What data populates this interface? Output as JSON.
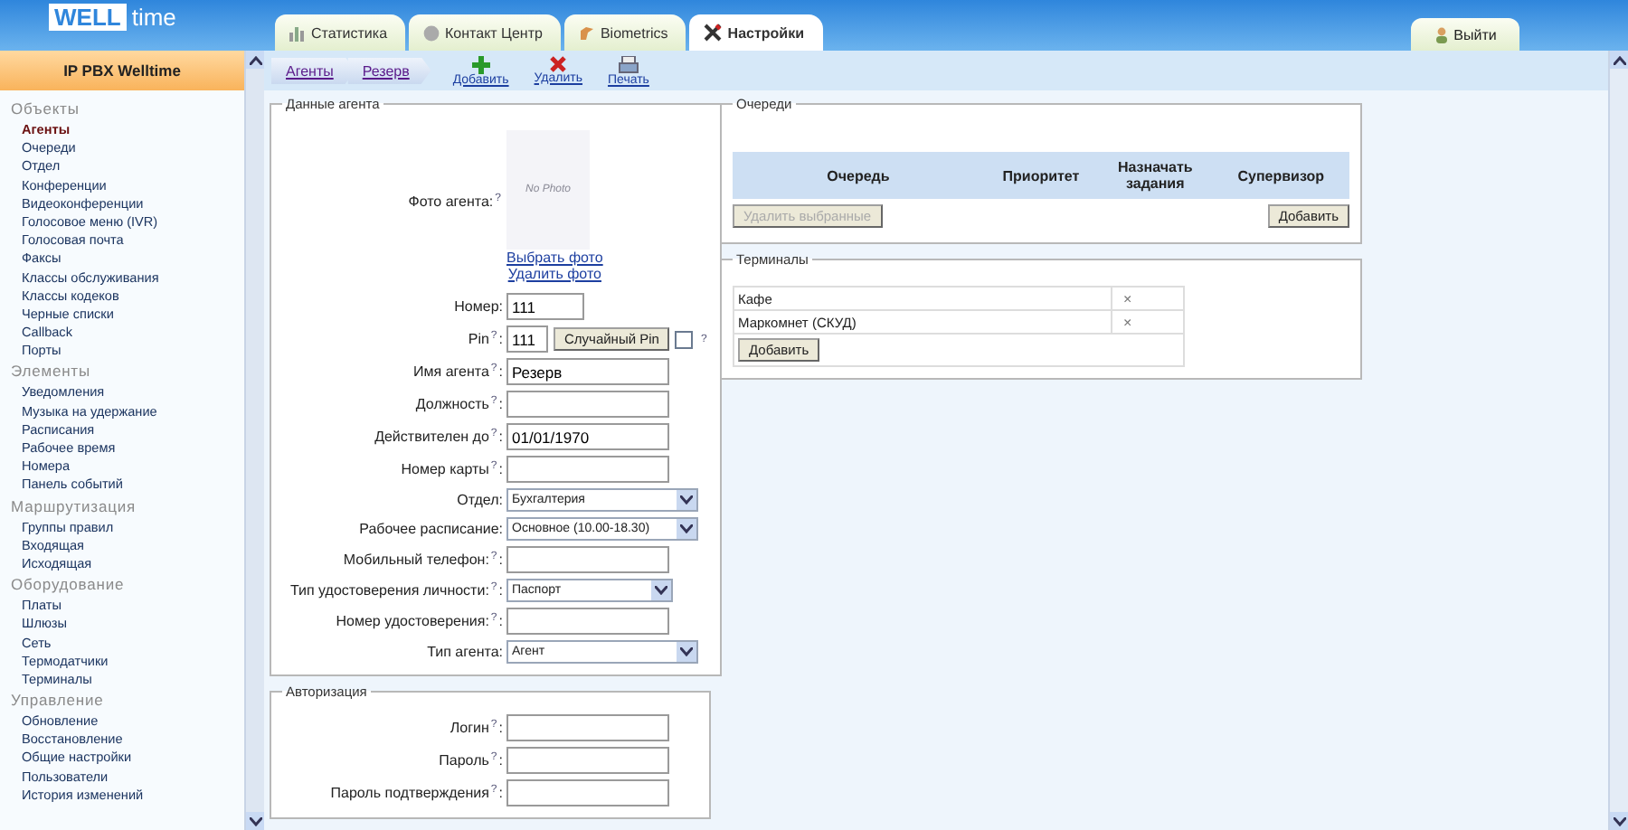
{
  "logo": {
    "part1": "WELL",
    "part2": "time"
  },
  "tabs": [
    {
      "label": "Статистика",
      "kind": "stats",
      "selected": false
    },
    {
      "label": "Контакт Центр",
      "kind": "contact",
      "selected": false
    },
    {
      "label": "Biometrics",
      "kind": "biometrics",
      "selected": false
    },
    {
      "label": "Настройки",
      "kind": "settings",
      "selected": true
    }
  ],
  "logout": "Выйти",
  "sidebar": {
    "title": "IP PBX Welltime",
    "groups": [
      {
        "title": "Объекты",
        "items": [
          {
            "label": "Агенты",
            "selected": true
          },
          {
            "label": "Очереди",
            "selected": false
          },
          {
            "label": "Отдел",
            "selected": false
          },
          {
            "label": "Конференции",
            "selected": false
          },
          {
            "label": "Видеоконференции",
            "selected": false
          },
          {
            "label": "Голосовое меню (IVR)",
            "selected": false
          },
          {
            "label": "Голосовая почта",
            "selected": false
          },
          {
            "label": "Факсы",
            "selected": false
          },
          {
            "label": "Классы обслуживания",
            "selected": false
          },
          {
            "label": "Классы кодеков",
            "selected": false
          },
          {
            "label": "Черные списки",
            "selected": false
          },
          {
            "label": "Callback",
            "selected": false
          },
          {
            "label": "Порты",
            "selected": false
          }
        ]
      },
      {
        "title": "Элементы",
        "items": [
          {
            "label": "Уведомления",
            "selected": false
          },
          {
            "label": "Музыка на удержание",
            "selected": false
          },
          {
            "label": "Расписания",
            "selected": false
          },
          {
            "label": "Рабочее время",
            "selected": false
          },
          {
            "label": "Номера",
            "selected": false
          },
          {
            "label": "Панель событий",
            "selected": false
          }
        ]
      },
      {
        "title": "Маршрутизация",
        "items": [
          {
            "label": "Группы правил",
            "selected": false
          },
          {
            "label": "Входящая",
            "selected": false
          },
          {
            "label": "Исходящая",
            "selected": false
          }
        ]
      },
      {
        "title": "Оборудование",
        "items": [
          {
            "label": "Платы",
            "selected": false
          },
          {
            "label": "Шлюзы",
            "selected": false
          },
          {
            "label": "Сеть",
            "selected": false
          },
          {
            "label": "Термодатчики",
            "selected": false
          },
          {
            "label": "Терминалы",
            "selected": false
          }
        ]
      },
      {
        "title": "Управление",
        "items": [
          {
            "label": "Обновление",
            "selected": false
          },
          {
            "label": "Восстановление",
            "selected": false
          },
          {
            "label": "Общие настройки",
            "selected": false
          },
          {
            "label": "Пользователи",
            "selected": false
          },
          {
            "label": "История изменений",
            "selected": false
          }
        ]
      }
    ]
  },
  "breadcrumb": [
    "Агенты",
    "Резерв"
  ],
  "actions": [
    {
      "label": "Добавить",
      "kind": "add"
    },
    {
      "label": "Удалить",
      "kind": "delete"
    },
    {
      "label": "Печать",
      "kind": "print"
    }
  ],
  "agent_data": {
    "legend": "Данные агента",
    "photo": {
      "label": "Фото агента:",
      "help": "?",
      "placeholder": "No Photo",
      "links": [
        "Выбрать фото",
        "Удалить фото"
      ]
    },
    "fields": [
      {
        "kind": "short",
        "label": "Номер:",
        "value": "111"
      },
      {
        "kind": "pin",
        "label": "Pin",
        "help": "?",
        "suffix": ":",
        "value": "111",
        "button": "Случайный Pin",
        "checked": false,
        "check_help": "?"
      },
      {
        "kind": "text",
        "label": "Имя агента",
        "help": "?",
        "suffix": ":",
        "value": "Резерв"
      },
      {
        "kind": "text",
        "label": "Должность",
        "help": "?",
        "suffix": ":"
      },
      {
        "kind": "text",
        "label": "Действителен до",
        "help": "?",
        "suffix": ":",
        "value": "01/01/1970"
      },
      {
        "kind": "text",
        "label": "Номер карты",
        "help": "?",
        "suffix": ":"
      },
      {
        "kind": "select",
        "label": "Отдел:",
        "value": "Бухгалтерия"
      },
      {
        "kind": "select",
        "label": "Рабочее расписание:",
        "value": "Основное (10.00-18.30)"
      },
      {
        "kind": "text",
        "label": "Мобильный телефон:",
        "help": "?",
        "suffix": ":"
      },
      {
        "kind": "select_narrow",
        "label": "Тип удостоверения личности:",
        "help": "?",
        "suffix": ":",
        "value": "Паспорт"
      },
      {
        "kind": "text",
        "label": "Номер удостоверения:",
        "help": "?",
        "suffix": ":"
      },
      {
        "kind": "select",
        "label": "Тип агента:",
        "value": "Агент"
      }
    ]
  },
  "authorization": {
    "legend": "Авторизация",
    "fields": [
      {
        "kind": "text",
        "label": "Логин",
        "help": "?",
        "suffix": ":"
      },
      {
        "kind": "text",
        "label": "Пароль",
        "help": "?",
        "suffix": ":"
      },
      {
        "kind": "text",
        "label": "Пароль подтверждения",
        "help": "?",
        "suffix": ":"
      }
    ]
  },
  "queues": {
    "legend": "Очереди",
    "columns": [
      "Очередь",
      "Приоритет",
      "Назначать задания",
      "Супервизор"
    ],
    "delete_button": {
      "label": "Удалить выбранные",
      "disabled": true
    },
    "add_button": "Добавить"
  },
  "terminals": {
    "legend": "Терминалы",
    "rows": [
      {
        "name": "Кафе",
        "remove": "×"
      },
      {
        "name": "Маркомнет (СКУД)",
        "remove": "×"
      }
    ],
    "add_button": "Добавить"
  }
}
